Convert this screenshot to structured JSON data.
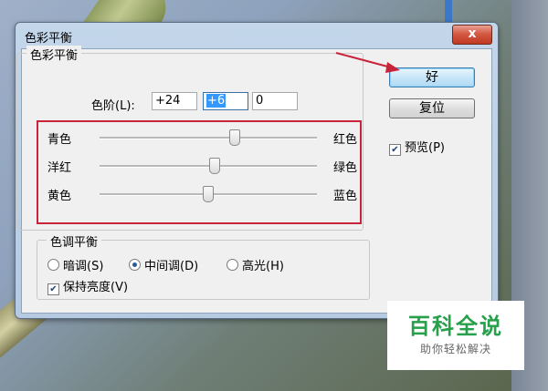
{
  "dialog": {
    "title": "色彩平衡",
    "close_label": "x"
  },
  "color_balance": {
    "legend": "色彩平衡",
    "levels_label": "色阶(L):",
    "levels": [
      "+24",
      "+6",
      "0"
    ],
    "sliders": [
      {
        "left": "青色",
        "right": "红色",
        "value": 24
      },
      {
        "left": "洋红",
        "right": "绿色",
        "value": 6
      },
      {
        "left": "黄色",
        "right": "蓝色",
        "value": 0
      }
    ],
    "slider_range": [
      -100,
      100
    ]
  },
  "tone_balance": {
    "legend": "色调平衡",
    "options": [
      {
        "label": "暗调(S)",
        "selected": false
      },
      {
        "label": "中间调(D)",
        "selected": true
      },
      {
        "label": "高光(H)",
        "selected": false
      }
    ],
    "preserve_luminosity": {
      "label": "保持亮度(V)",
      "checked": true
    }
  },
  "buttons": {
    "ok": "好",
    "reset": "复位"
  },
  "preview": {
    "label": "预览(P)",
    "checked": true
  },
  "watermark": {
    "title": "百科全说",
    "subtitle": "助你轻松解决"
  },
  "colors": {
    "highlight_box": "#c8233a",
    "selection": "#3399ff",
    "watermark_green": "#26a04a"
  }
}
